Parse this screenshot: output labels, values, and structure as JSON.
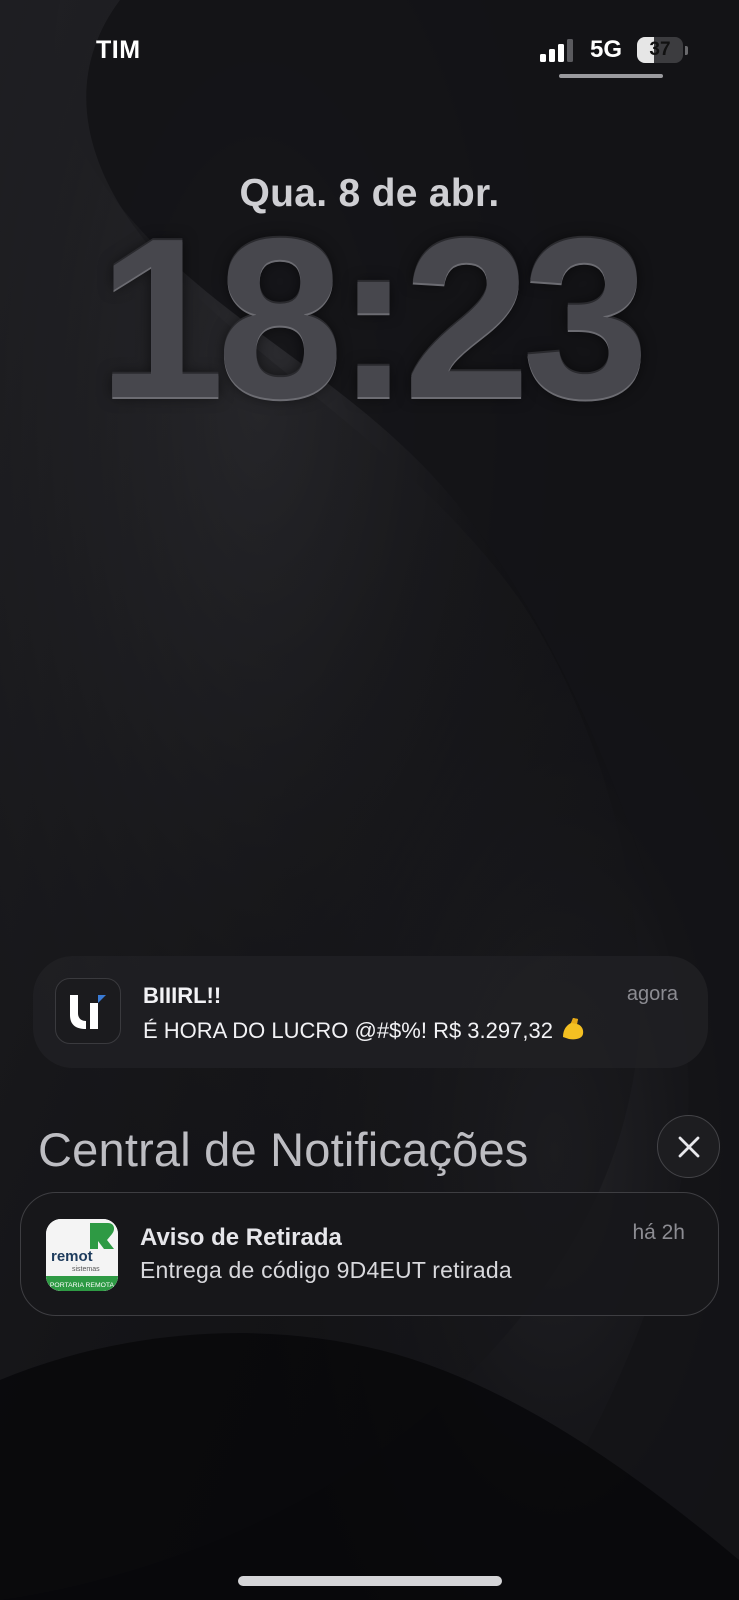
{
  "status_bar": {
    "carrier": "TIM",
    "network_type": "5G",
    "battery_level": "37",
    "battery_fraction": 0.37
  },
  "lock_screen": {
    "date": "Qua. 8 de abr.",
    "time": "18:23"
  },
  "notification": {
    "title": "BIIIRL!!",
    "time": "agora",
    "body": "É HORA DO LUCRO @#$%! R$ 3.297,32",
    "emoji": "💪",
    "app_icon": "u-logo-icon"
  },
  "notification_center": {
    "title": "Central de Notificações",
    "clear_icon": "close-icon",
    "items": [
      {
        "title": "Aviso de Retirada",
        "time": "há 2h",
        "body": "Entrega de código 9D4EUT retirada",
        "app_icon": "remot-app-icon",
        "icon_brand": "remot",
        "icon_subtext": "sistemas",
        "icon_tagline": "PORTARIA REMOTA"
      }
    ]
  },
  "colors": {
    "background": "#0d0d10",
    "notification_bg": "#1f1f22",
    "accent_blue": "#3a7bd5",
    "remot_green": "#2e9a44"
  }
}
